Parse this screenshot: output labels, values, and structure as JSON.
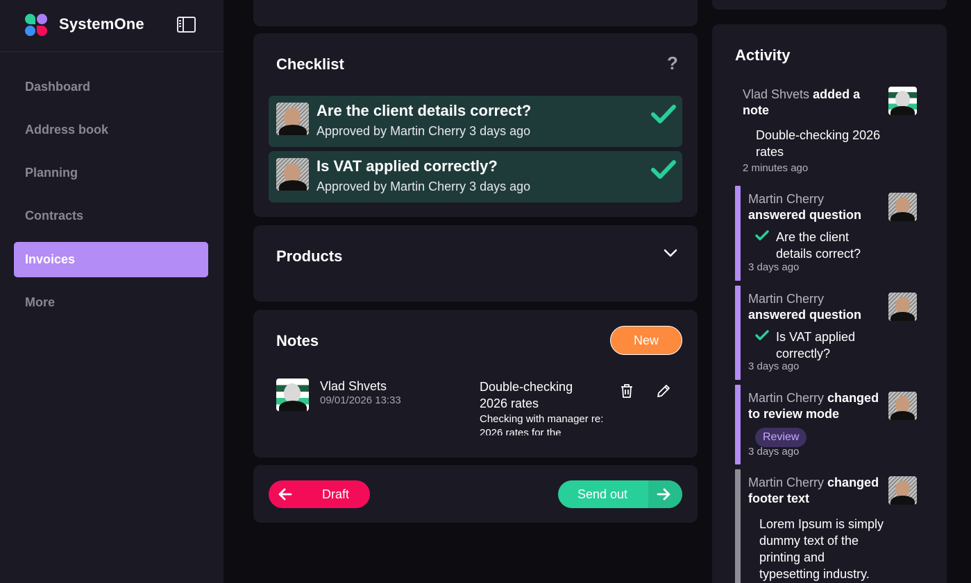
{
  "brand": {
    "name": "SystemOne"
  },
  "sidebar": {
    "items": [
      {
        "label": "Dashboard"
      },
      {
        "label": "Address book"
      },
      {
        "label": "Planning"
      },
      {
        "label": "Contracts"
      },
      {
        "label": "Invoices",
        "active": true
      },
      {
        "label": "More"
      }
    ]
  },
  "checklist": {
    "title": "Checklist",
    "help": "?",
    "items": [
      {
        "question": "Are the client details correct?",
        "status": "Approved by Martin Cherry 3 days ago"
      },
      {
        "question": "Is VAT applied correctly?",
        "status": "Approved by Martin Cherry 3 days ago"
      }
    ]
  },
  "products": {
    "title": "Products"
  },
  "notes": {
    "title": "Notes",
    "new_label": "New",
    "items": [
      {
        "author": "Vlad Shvets",
        "datetime": "09/01/2026 13:33",
        "title": "Double-checking 2026 rates",
        "body": "Checking with manager re: 2026 rates for the"
      }
    ]
  },
  "footer_actions": {
    "draft_label": "Draft",
    "send_label": "Send out"
  },
  "activity": {
    "title": "Activity",
    "items": [
      {
        "who": "Vlad Shvets",
        "action": "added a note",
        "detail": "Double-checking 2026 rates",
        "time": "2 minutes ago"
      },
      {
        "who": "Martin Cherry",
        "action": "answered question",
        "detail": "Are the client details correct?",
        "time": "3 days ago"
      },
      {
        "who": "Martin Cherry",
        "action": "answered question",
        "detail": "Is VAT applied correctly?",
        "time": "3 days ago"
      },
      {
        "who": "Martin Cherry",
        "action": "changed to review mode",
        "badge": "Review",
        "time": "3 days ago"
      },
      {
        "who": "Martin Cherry",
        "action": "changed footer text",
        "detail": "Lorem Ipsum is simply dummy text of the printing and typesetting industry."
      }
    ]
  },
  "colors": {
    "accent": "#b38cf5",
    "success": "#29cf98",
    "danger": "#f30d58",
    "orange": "#fe8a3e",
    "card": "#1b1924",
    "check_bg": "#1e3b3a"
  }
}
